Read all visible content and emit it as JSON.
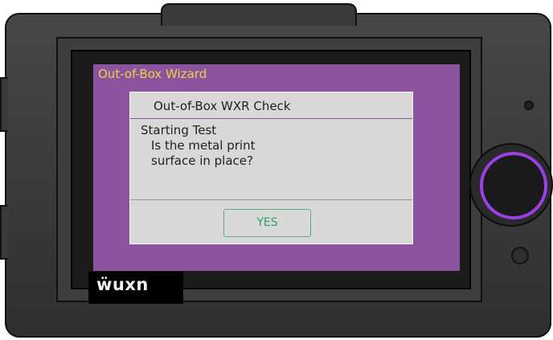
{
  "screen": {
    "wizard_title": "Out-of-Box Wizard",
    "background_color": "#8c539f",
    "title_color": "#f2cf45"
  },
  "dialog": {
    "title": "Out-of-Box WXR Check",
    "body_lines": [
      "Starting Test",
      "Is the metal print",
      "surface in place?"
    ],
    "yes_label": "YES",
    "button_color": "#2f9d5e"
  },
  "device": {
    "logo": "ẅuxn",
    "knob_ring_color": "#9b3fe6",
    "knob_icon": "rotary-knob",
    "led_icon": "status-led",
    "button_icon": "circle-button"
  }
}
